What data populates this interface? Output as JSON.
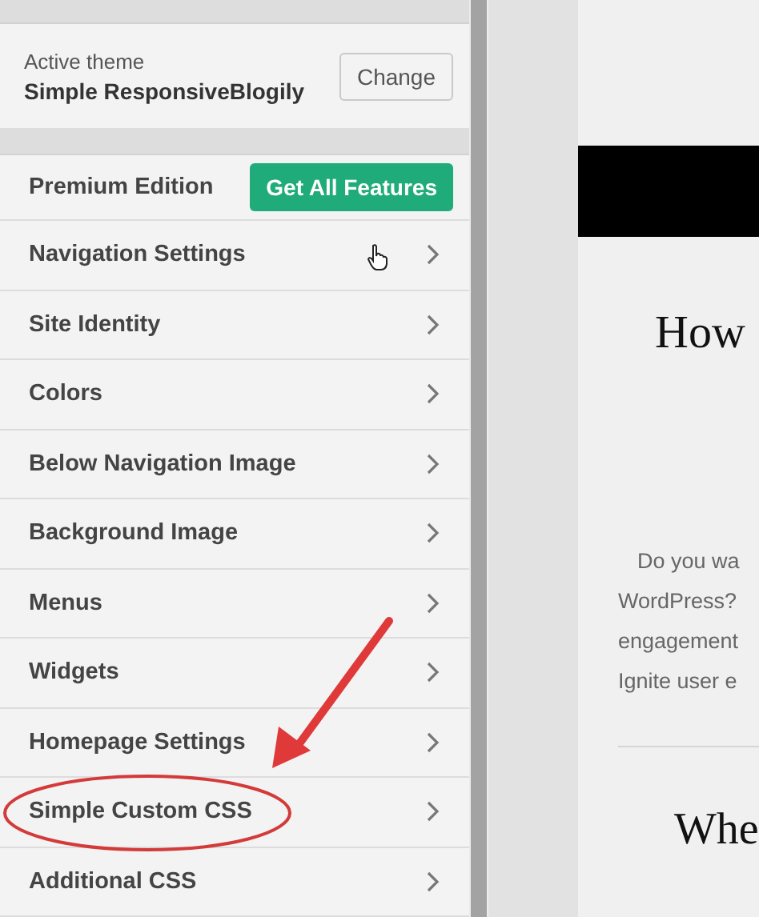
{
  "theme": {
    "caption": "Active theme",
    "name": "Simple ResponsiveBlogily",
    "button": "Change"
  },
  "premium": {
    "label": "Premium Edition",
    "button": "Get All Features"
  },
  "menu": [
    {
      "label": "Navigation Settings",
      "hovered": true
    },
    {
      "label": "Site Identity",
      "hovered": false
    },
    {
      "label": "Colors",
      "hovered": false
    },
    {
      "label": "Below Navigation Image",
      "hovered": false
    },
    {
      "label": "Background Image",
      "hovered": false
    },
    {
      "label": "Menus",
      "hovered": false
    },
    {
      "label": "Widgets",
      "hovered": false
    },
    {
      "label": "Homepage Settings",
      "hovered": false
    },
    {
      "label": "Simple Custom CSS",
      "hovered": false,
      "circled": true
    },
    {
      "label": "Additional CSS",
      "hovered": false
    }
  ],
  "preview": {
    "heading": "How",
    "paragraph_lines": [
      "Do you wa",
      "WordPress?",
      "engagement",
      "Ignite user e"
    ],
    "heading_2": "Whe"
  }
}
